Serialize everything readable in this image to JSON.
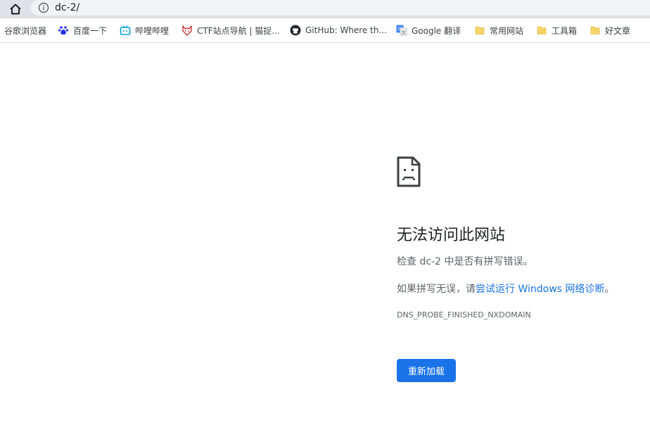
{
  "address_bar": {
    "url": "dc-2/"
  },
  "bookmarks": [
    {
      "label": "谷歌浏览器",
      "icon": "none"
    },
    {
      "label": "百度一下",
      "icon": "baidu-paw-icon",
      "color": "#2932e1"
    },
    {
      "label": "哔哩哔哩",
      "icon": "bilibili-tv-icon",
      "color": "#00a1d6"
    },
    {
      "label": "CTF站点导航 | 猫捉...",
      "icon": "fox-icon",
      "color": "#c62828"
    },
    {
      "label": "GitHub: Where th...",
      "icon": "github-icon",
      "color": "#24292e"
    },
    {
      "label": "Google 翻译",
      "icon": "google-translate-icon",
      "color": "#4285f4"
    },
    {
      "label": "常用网站",
      "icon": "folder-icon",
      "color": "#f6d365"
    },
    {
      "label": "工具箱",
      "icon": "folder-icon",
      "color": "#f6d365"
    },
    {
      "label": "好文章",
      "icon": "folder-icon",
      "color": "#f6d365"
    }
  ],
  "error": {
    "title": "无法访问此网站",
    "line1": "检查 dc-2 中是否有拼写错误。",
    "line2_prefix": "如果拼写无误，请",
    "line2_link": "尝试运行 Windows 网络诊断",
    "line2_suffix": "。",
    "code": "DNS_PROBE_FINISHED_NXDOMAIN",
    "reload_label": "重新加载"
  },
  "colors": {
    "accent": "#1a73e8",
    "toolbar": "#dee1e6",
    "omnibox": "#f1f3f4"
  }
}
